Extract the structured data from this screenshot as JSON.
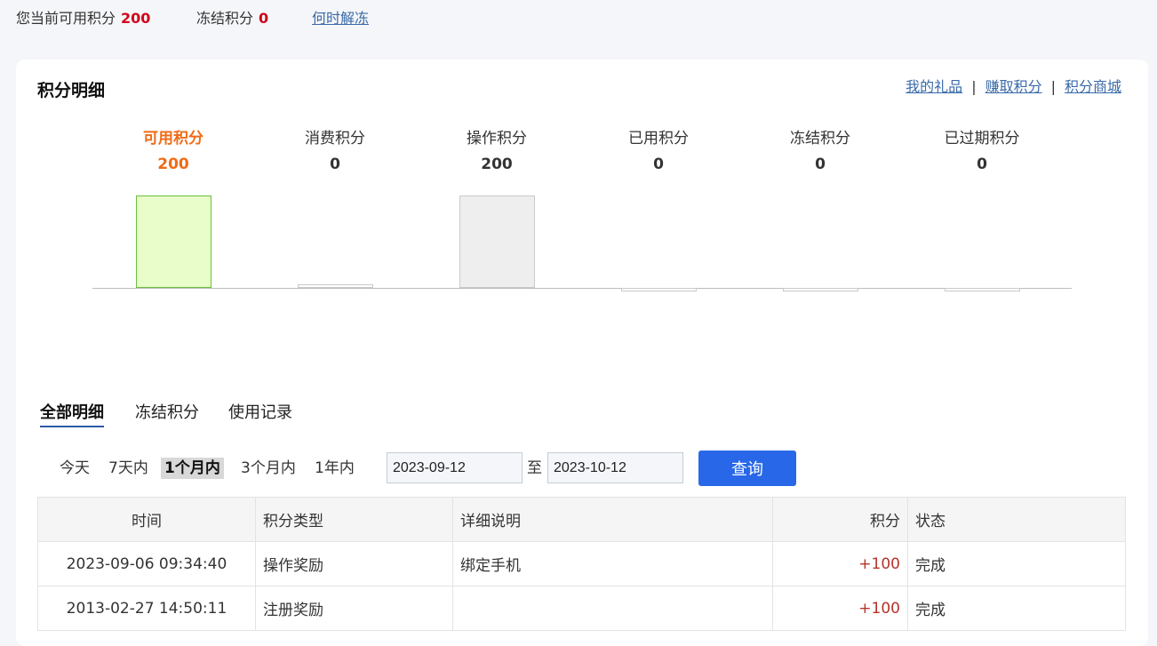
{
  "summary": {
    "available_label": "您当前可用积分",
    "available_value": "200",
    "frozen_label": "冻结积分",
    "frozen_value": "0",
    "unfreeze_link": "何时解冻"
  },
  "card": {
    "title": "积分明细",
    "links": [
      "我的礼品",
      "赚取积分",
      "积分商城"
    ],
    "link_separator": "|"
  },
  "chart_data": {
    "type": "bar",
    "categories": [
      "可用积分",
      "消费积分",
      "操作积分",
      "已用积分",
      "冻结积分",
      "已过期积分"
    ],
    "values": [
      200,
      0,
      200,
      0,
      0,
      0
    ],
    "value_labels": [
      "200",
      "0",
      "200",
      "0",
      "0",
      "0"
    ],
    "highlight_index": 0,
    "colors": {
      "highlight_fill": "#e8fdc9",
      "highlight_border": "#6cbf3f",
      "normal_fill": "#eeeeee",
      "normal_border": "#c9c9c9",
      "highlight_text": "#ef6b16"
    },
    "ylim": [
      0,
      200
    ],
    "grid": false,
    "legend": "none",
    "title": "",
    "xlabel": "",
    "ylabel": ""
  },
  "tabs": [
    {
      "label": "全部明细",
      "active": true
    },
    {
      "label": "冻结积分",
      "active": false
    },
    {
      "label": "使用记录",
      "active": false
    }
  ],
  "filter": {
    "ranges": [
      "今天",
      "7天内",
      "1个月内",
      "3个月内",
      "1年内"
    ],
    "active_range": "1个月内",
    "start_date": "2023-09-12",
    "to_label": "至",
    "end_date": "2023-10-12",
    "query_button": "查询"
  },
  "table": {
    "headers": [
      "时间",
      "积分类型",
      "详细说明",
      "积分",
      "状态"
    ],
    "rows": [
      {
        "time": "2023-09-06 09:34:40",
        "type": "操作奖励",
        "desc": "绑定手机",
        "points": "+100",
        "status": "完成"
      },
      {
        "time": "2013-02-27 14:50:11",
        "type": "注册奖励",
        "desc": "",
        "points": "+100",
        "status": "完成"
      }
    ]
  },
  "colors": {
    "accent_blue": "#2868e8",
    "red_number": "#d0021b",
    "link": "#3a6aa8"
  }
}
